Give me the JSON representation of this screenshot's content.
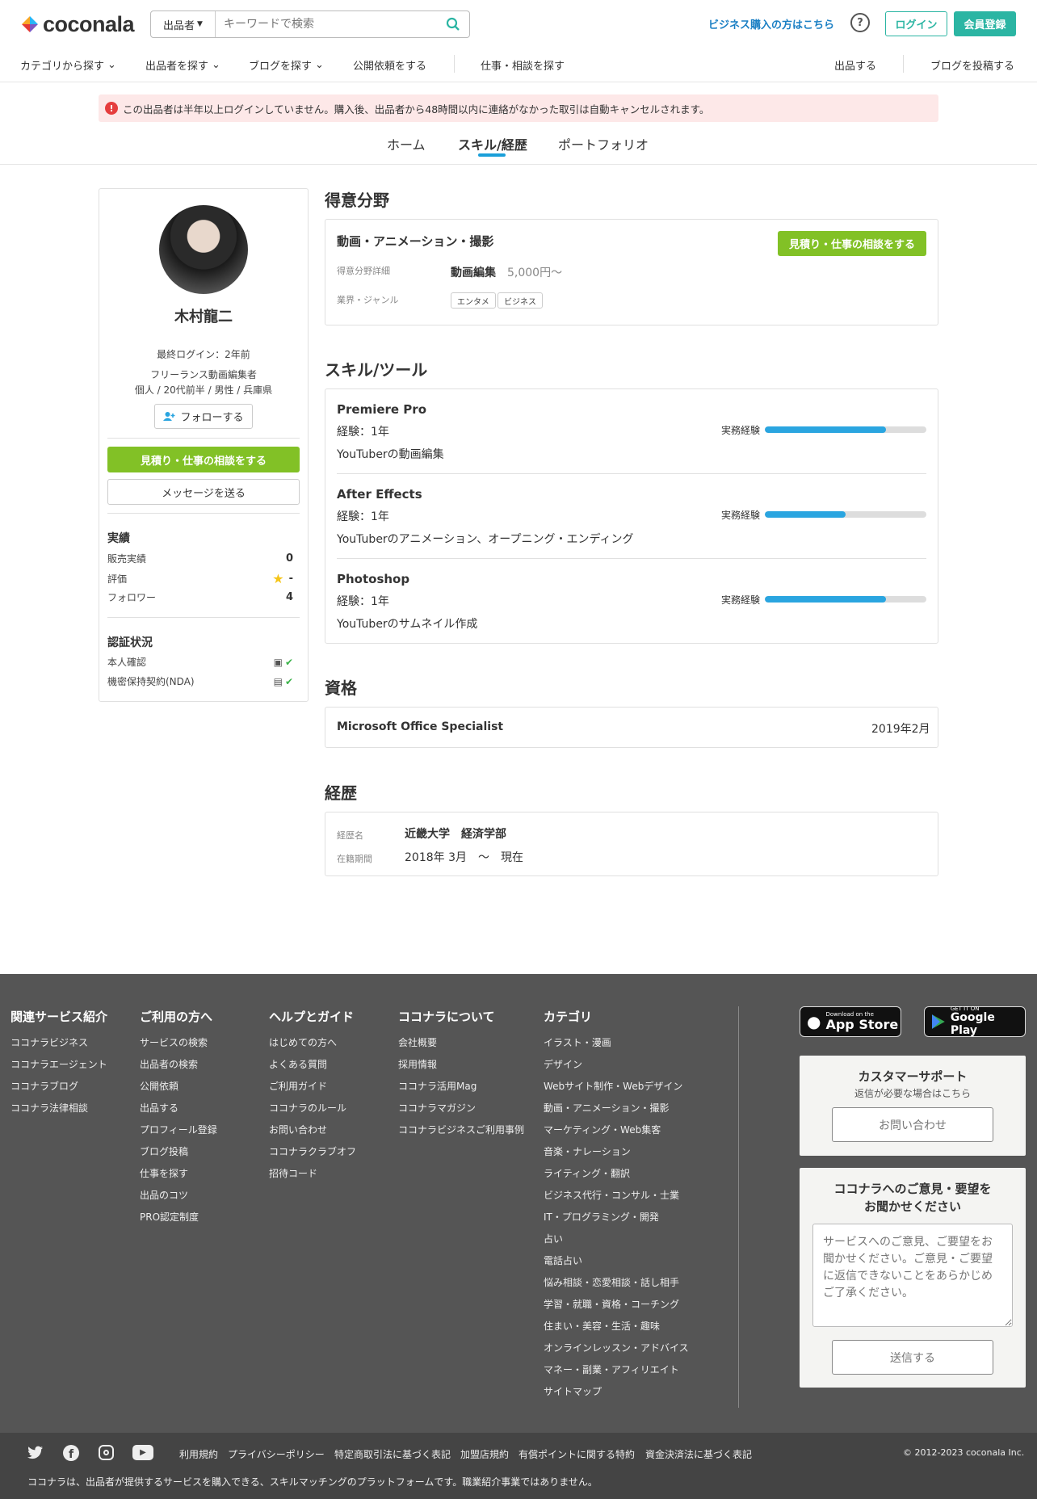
{
  "header": {
    "logo": "coconala",
    "search_select": "出品者",
    "search_placeholder": "キーワードで検索",
    "biz_link": "ビジネス購入の方はこちら",
    "help": "?",
    "login": "ログイン",
    "signup": "会員登録"
  },
  "nav": {
    "left": [
      "カテゴリから探す",
      "出品者を探す",
      "ブログを探す",
      "公開依頼をする",
      "仕事・相談を探す"
    ],
    "right": [
      "出品する",
      "ブログを投稿する"
    ]
  },
  "alert": "この出品者は半年以上ログインしていません。購入後、出品者から48時間以内に連絡がなかった取引は自動キャンセルされます。",
  "tabs": [
    "ホーム",
    "スキル/経歴",
    "ポートフォリオ"
  ],
  "profile": {
    "name": "木村龍二",
    "last_login": "最終ログイン：2年前",
    "title": "フリーランス動画編集者",
    "meta": "個人 / 20代前半 / 男性 / 兵庫県",
    "follow": "フォローする",
    "consult": "見積り・仕事の相談をする",
    "message": "メッセージを送る",
    "stats_title": "実績",
    "stats": [
      {
        "label": "販売実績",
        "value": "0"
      },
      {
        "label": "評価",
        "value": "-"
      },
      {
        "label": "フォロワー",
        "value": "4"
      }
    ],
    "verify_title": "認証状況",
    "verify": [
      "本人確認",
      "機密保持契約(NDA)"
    ]
  },
  "specialty": {
    "heading": "得意分野",
    "title": "動画・アニメーション・撮影",
    "button": "見積り・仕事の相談をする",
    "detail_label": "得意分野詳細",
    "detail_name": "動画編集",
    "detail_price": "5,000円〜",
    "genre_label": "業界・ジャンル",
    "genres": [
      "エンタメ",
      "ビジネス"
    ]
  },
  "skills": {
    "heading": "スキル/ツール",
    "bar_label": "実務経験",
    "items": [
      {
        "name": "Premiere Pro",
        "exp": "経験：1年",
        "desc": "YouTuberの動画編集",
        "level": 0.75
      },
      {
        "name": "After Effects",
        "exp": "経験：1年",
        "desc": "YouTuberのアニメーション、オープニング・エンディング",
        "level": 0.5
      },
      {
        "name": "Photoshop",
        "exp": "経験：1年",
        "desc": "YouTuberのサムネイル作成",
        "level": 0.75
      }
    ]
  },
  "qualification": {
    "heading": "資格",
    "name": "Microsoft Office Specialist",
    "date": "2019年2月"
  },
  "career": {
    "heading": "経歴",
    "name_label": "経歴名",
    "name": "近畿大学　経済学部",
    "period_label": "在籍期間",
    "period": "2018年 3月　〜　現在"
  },
  "footer": {
    "columns": [
      {
        "title": "関連サービス紹介",
        "links": [
          "ココナラビジネス",
          "ココナラエージェント",
          "ココナラブログ",
          "ココナラ法律相談"
        ]
      },
      {
        "title": "ご利用の方へ",
        "links": [
          "サービスの検索",
          "出品者の検索",
          "公開依頼",
          "出品する",
          "プロフィール登録",
          "ブログ投稿",
          "仕事を探す",
          "出品のコツ",
          "PRO認定制度"
        ]
      },
      {
        "title": "ヘルプとガイド",
        "links": [
          "はじめての方へ",
          "よくある質問",
          "ご利用ガイド",
          "ココナラのルール",
          "お問い合わせ",
          "ココナラクラブオフ",
          "招待コード"
        ]
      },
      {
        "title": "ココナラについて",
        "links": [
          "会社概要",
          "採用情報",
          "ココナラ活用Mag",
          "ココナラマガジン",
          "ココナラビジネスご利用事例"
        ]
      },
      {
        "title": "カテゴリ",
        "links": [
          "イラスト・漫画",
          "デザイン",
          "Webサイト制作・Webデザイン",
          "動画・アニメーション・撮影",
          "マーケティング・Web集客",
          "音楽・ナレーション",
          "ライティング・翻訳",
          "ビジネス代行・コンサル・士業",
          "IT・プログラミング・開発",
          "占い",
          "電話占い",
          "悩み相談・恋愛相談・話し相手",
          "学習・就職・資格・コーチング",
          "住まい・美容・生活・趣味",
          "オンラインレッスン・アドバイス",
          "マネー・副業・アフィリエイト",
          "サイトマップ"
        ]
      }
    ],
    "appstore_small": "Download on the",
    "appstore": "App Store",
    "gplay_small": "GET IT ON",
    "gplay": "Google Play",
    "support_title": "カスタマーサポート",
    "support_sub": "返信が必要な場合はこちら",
    "support_btn": "お問い合わせ",
    "feedback_title1": "ココナラへのご意見・要望を",
    "feedback_title2": "お聞かせください",
    "feedback_placeholder": "サービスへのご意見、ご要望をお聞かせください。ご意見・ご要望に返信できないことをあらかじめご了承ください。",
    "feedback_btn": "送信する",
    "legal": [
      "利用規約",
      "プライバシーポリシー",
      "特定商取引法に基づく表記",
      "加盟店規約",
      "有償ポイントに関する特約",
      "資金決済法に基づく表記"
    ],
    "copyright": "© 2012-2023 coconala Inc.",
    "note": "ココナラは、出品者が提供するサービスを購入できる、スキルマッチングのプラットフォームです。職業紹介事業ではありません。"
  },
  "colors": {
    "accent": "#2bb5a3",
    "green": "#82c126",
    "bar": "#2aa5e0",
    "link": "#1a7fc4",
    "alert_bg": "#fde8e8"
  }
}
